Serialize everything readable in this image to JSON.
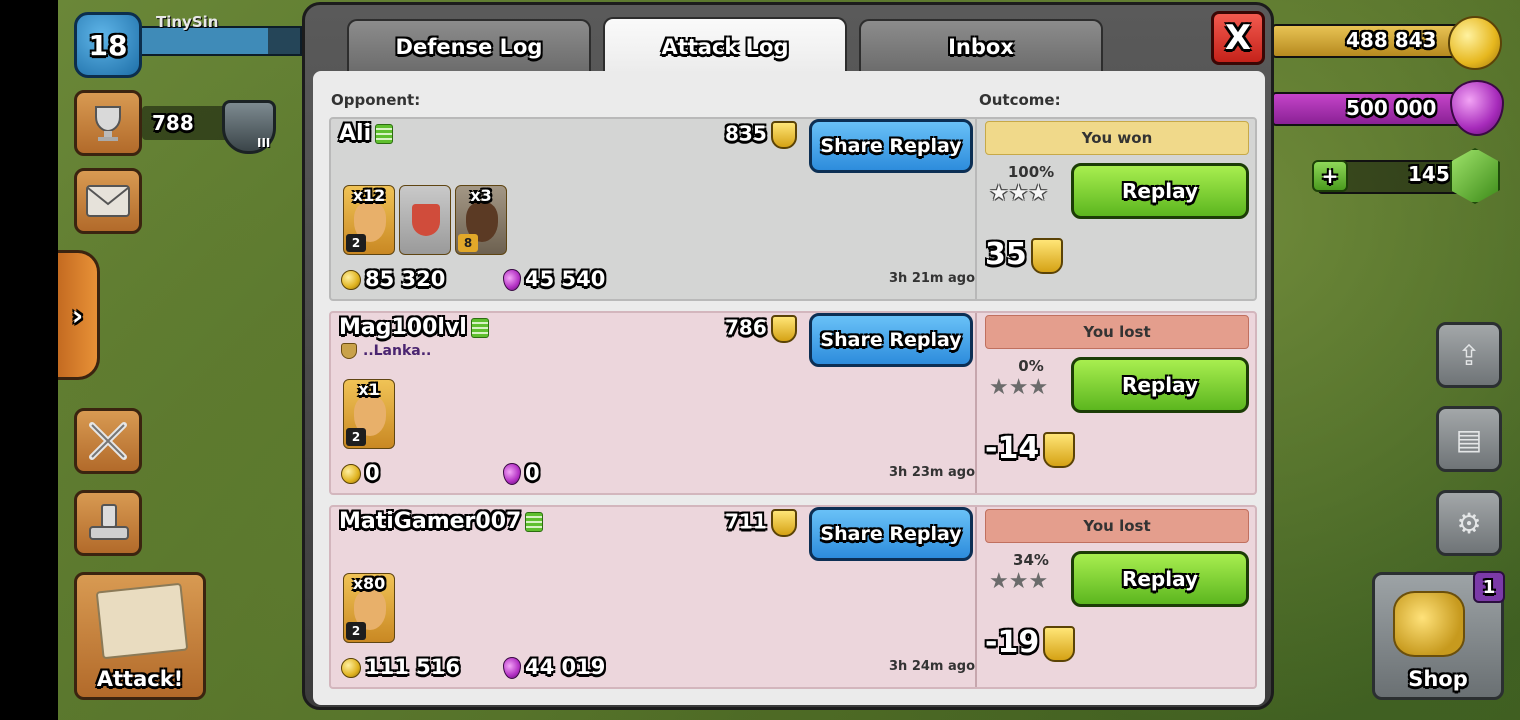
{
  "hud": {
    "player_name": "TinySin",
    "level": "18",
    "xp_fill_fraction": 0.8,
    "trophies": "788",
    "league_rank": "III",
    "side_tab_label": "›",
    "attack_label": "Attack!",
    "gold": "488 843",
    "elixir": "500 000",
    "gems": "145",
    "gem_plus": "+",
    "shop_label": "Shop",
    "shop_badge": "1"
  },
  "tabs": [
    {
      "label": "Defense Log",
      "active": false
    },
    {
      "label": "Attack Log",
      "active": true
    },
    {
      "label": "Inbox",
      "active": false
    }
  ],
  "close_label": "X",
  "columns": {
    "opponent": "Opponent:",
    "outcome": "Outcome:"
  },
  "share_label": "Share Replay",
  "replay_label": "Replay",
  "entries": [
    {
      "name": "Ali",
      "clan": "",
      "trophies": "835",
      "troops": [
        {
          "type": "barbarian",
          "count": "x12",
          "level": "2"
        },
        {
          "type": "clan-castle",
          "count": "",
          "level": ""
        },
        {
          "type": "hog-rider",
          "count": "x3",
          "level": "8"
        }
      ],
      "gold": "85 320",
      "elixir": "45 540",
      "time": "3h 21m ago",
      "result": "You won",
      "percent": "100%",
      "stars": 3,
      "trophy_change": "35"
    },
    {
      "name": "Mag100lvl",
      "clan": "..Lanka..",
      "trophies": "786",
      "troops": [
        {
          "type": "barbarian",
          "count": "x1",
          "level": "2"
        }
      ],
      "gold": "0",
      "elixir": "0",
      "time": "3h 23m ago",
      "result": "You lost",
      "percent": "0%",
      "stars": 0,
      "trophy_change": "-14"
    },
    {
      "name": "MatiGamer007",
      "clan": "",
      "trophies": "711",
      "troops": [
        {
          "type": "barbarian",
          "count": "x80",
          "level": "2"
        }
      ],
      "gold": "111 516",
      "elixir": "44 019",
      "time": "3h 24m ago",
      "result": "You lost",
      "percent": "34%",
      "stars": 0,
      "trophy_change": "-19"
    }
  ]
}
